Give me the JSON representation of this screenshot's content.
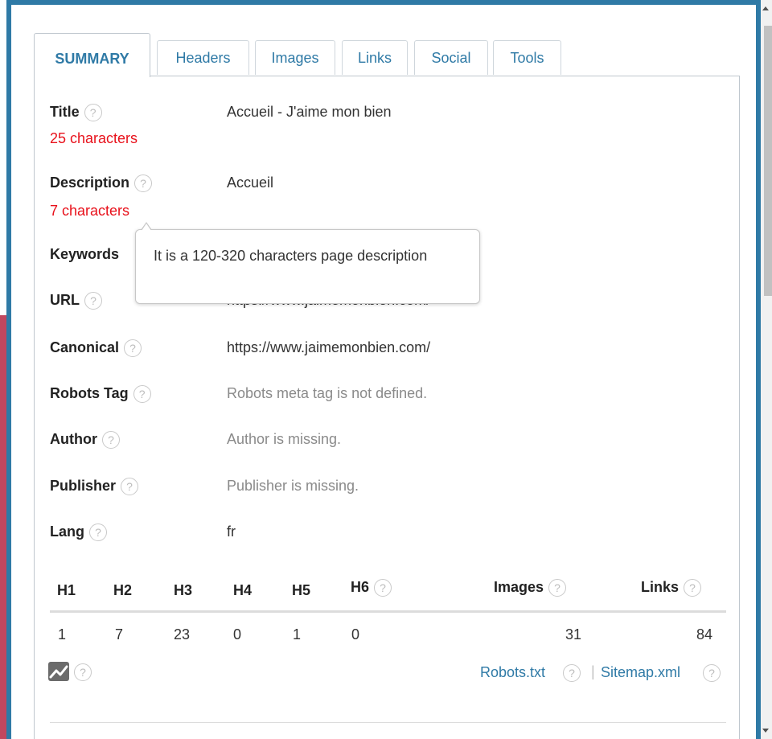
{
  "tabs": [
    {
      "label": "SUMMARY",
      "active": true
    },
    {
      "label": "Headers",
      "active": false
    },
    {
      "label": "Images",
      "active": false
    },
    {
      "label": "Links",
      "active": false
    },
    {
      "label": "Social",
      "active": false
    },
    {
      "label": "Tools",
      "active": false
    }
  ],
  "help_glyph": "?",
  "summary": {
    "title": {
      "label": "Title",
      "value": "Accueil - J'aime mon bien",
      "count": "25 characters"
    },
    "description": {
      "label": "Description",
      "value": "Accueil",
      "count": "7 characters"
    },
    "keywords": {
      "label": "Keywords"
    },
    "url": {
      "label": "URL",
      "value": "https://www.jaimemonbien.com/"
    },
    "canonical": {
      "label": "Canonical",
      "value": "https://www.jaimemonbien.com/"
    },
    "robots_tag": {
      "label": "Robots Tag",
      "value": "Robots meta tag is not defined."
    },
    "author": {
      "label": "Author",
      "value": "Author is missing."
    },
    "publisher": {
      "label": "Publisher",
      "value": "Publisher is missing."
    },
    "lang": {
      "label": "Lang",
      "value": "fr"
    }
  },
  "tooltip": {
    "text": "It is a 120-320 characters page description"
  },
  "counts_table": {
    "headers": [
      "H1",
      "H2",
      "H3",
      "H4",
      "H5",
      "H6",
      "Images",
      "Links"
    ],
    "values": [
      "1",
      "7",
      "23",
      "0",
      "1",
      "0",
      "31",
      "84"
    ]
  },
  "footer_links": {
    "robots": "Robots.txt",
    "separator": "|",
    "sitemap": "Sitemap.xml"
  },
  "colors": {
    "accent": "#2f7aa6",
    "count_red": "#e8111b",
    "frame_blue": "#2f7aa6",
    "left_pink": "#c2475f"
  },
  "icons": {
    "help": "question-circle-icon",
    "chart": "line-chart-icon"
  }
}
